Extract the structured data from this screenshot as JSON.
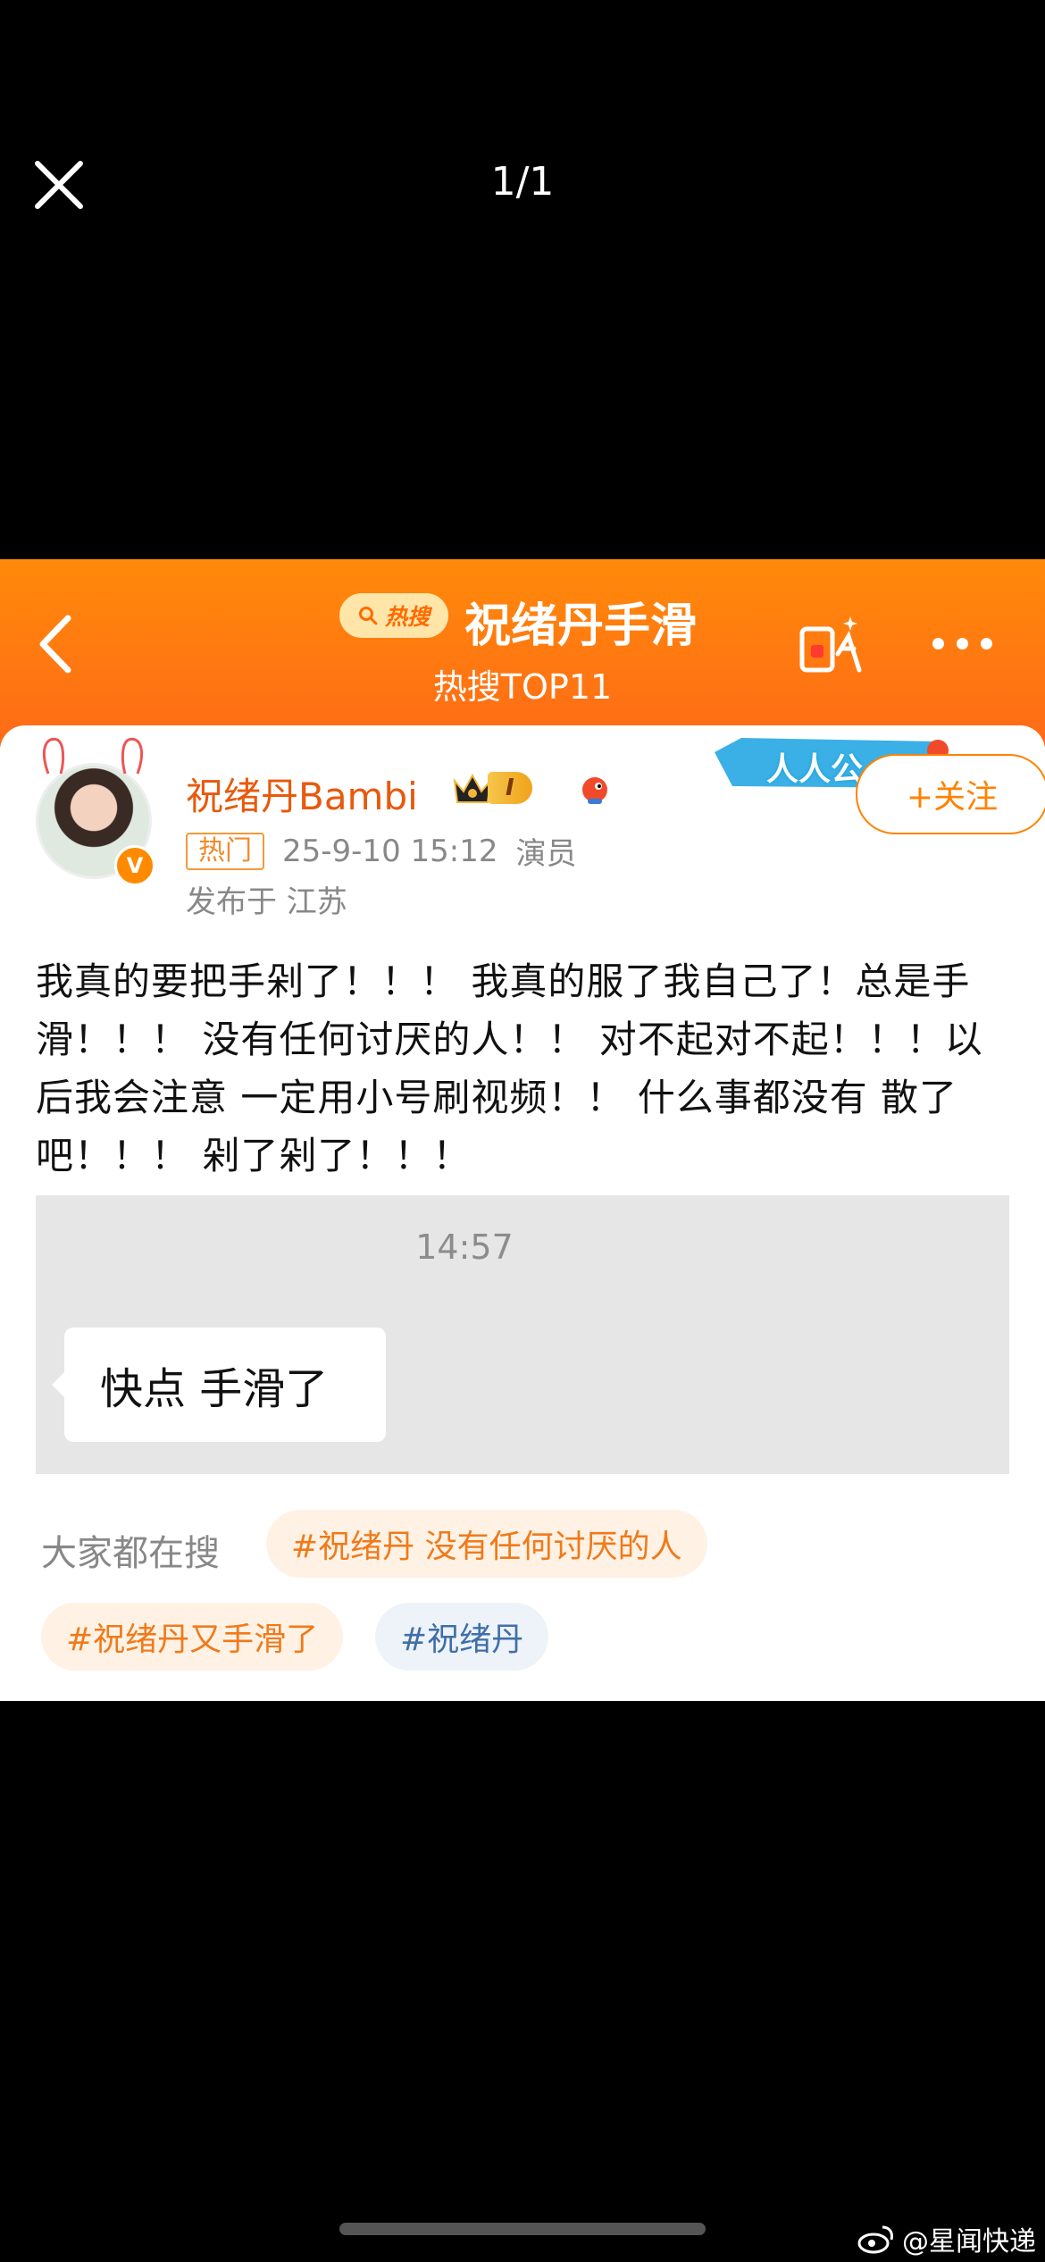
{
  "viewer": {
    "page_counter": "1/1"
  },
  "header": {
    "hot_pill_label": "热搜",
    "title": "祝绪丹手滑",
    "subtitle": "热搜TOP11"
  },
  "post": {
    "username": "祝绪丹Bambi",
    "vip_level": "I",
    "follow_label": "+关注",
    "ribbon_text": "人人公",
    "hot_tag": "热门",
    "time": "25-9-10 15:12",
    "identity": "演员",
    "location": "发布于 江苏",
    "text": "我真的要把手剁了！！！ 我真的服了我自己了！总是手滑！！！ 没有任何讨厌的人！！ 对不起对不起！！！以后我会注意 一定用小号刷视频！！ 什么事都没有 散了吧！！！ 剁了剁了！！！",
    "chat": {
      "time": "14:57",
      "message": "快点 手滑了"
    }
  },
  "search": {
    "label": "大家都在搜",
    "tags": [
      "#祝绪丹 没有任何讨厌的人",
      "#祝绪丹又手滑了",
      "#祝绪丹"
    ]
  },
  "watermark": "@星闻快递",
  "colors": {
    "orange": "#ff6a17",
    "accent": "#ff8200",
    "username": "#e8590c"
  }
}
